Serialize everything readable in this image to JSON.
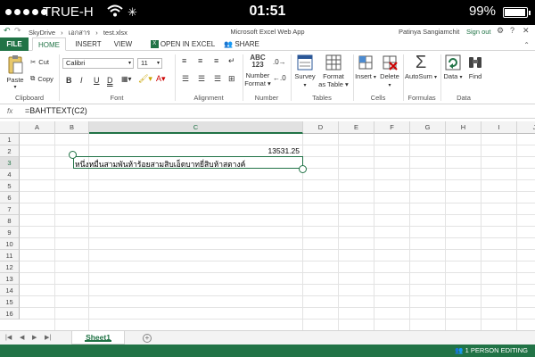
{
  "status": {
    "carrier": "TRUE-H",
    "time": "01:51",
    "battery": "99%"
  },
  "nav": {
    "breadcrumbs": [
      "SkyDrive",
      "›",
      "เอกสาร",
      "›",
      "test.xlsx"
    ],
    "app_title": "Microsoft Excel Web App",
    "user": "Patinya Sangiamchit",
    "signout": "Sign out"
  },
  "tabs": {
    "file": "FILE",
    "home": "HOME",
    "insert": "INSERT",
    "view": "VIEW",
    "open_in_excel": "OPEN IN EXCEL",
    "share": "SHARE"
  },
  "ribbon": {
    "clipboard": {
      "paste": "Paste",
      "cut": "Cut",
      "copy": "Copy",
      "label": "Clipboard"
    },
    "font": {
      "name": "Calibri",
      "size": "11",
      "label": "Font",
      "bold": "B",
      "italic": "I",
      "underline": "U",
      "double_underline": "D"
    },
    "alignment": {
      "label": "Alignment"
    },
    "number": {
      "line1": "Number",
      "line2": "Format",
      "label": "Number",
      "icon_text": "ABC 123"
    },
    "tables": {
      "survey": "Survey",
      "format_line1": "Format",
      "format_line2": "as Table",
      "label": "Tables"
    },
    "cells": {
      "insert": "Insert",
      "delete": "Delete",
      "label": "Cells"
    },
    "formulas": {
      "autosum": "AutoSum",
      "label": "Formulas"
    },
    "data": {
      "data": "Data",
      "find": "Find",
      "label": "Data"
    }
  },
  "formula_bar": {
    "fx": "fx",
    "formula": "=BAHTTEXT(C2)"
  },
  "grid": {
    "columns": [
      "A",
      "B",
      "C",
      "D",
      "E",
      "F",
      "G",
      "H",
      "I",
      "J"
    ],
    "rows": [
      "1",
      "2",
      "3",
      "4",
      "5",
      "6",
      "7",
      "8",
      "9",
      "10",
      "11",
      "12",
      "13",
      "14",
      "15",
      "16"
    ],
    "selected_column": "C",
    "selected_row": "3",
    "cells": {
      "C2": "13531.25",
      "C3": "หนึ่งหมื่นสามพันห้าร้อยสามสิบเอ็ดบาทยี่สิบห้าสตางค์"
    }
  },
  "sheets": {
    "active": "Sheet1"
  },
  "footer": {
    "editing": "1 PERSON EDITING"
  },
  "colors": {
    "accent": "#217346"
  }
}
